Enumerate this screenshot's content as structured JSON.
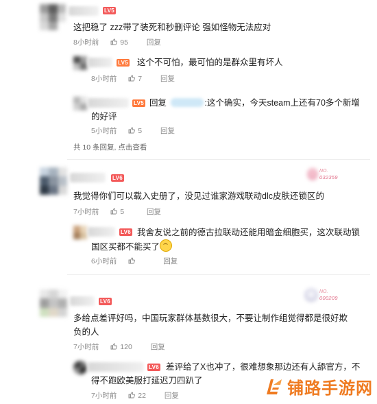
{
  "comments": [
    {
      "level": "LV5",
      "text": "这把稳了 zzz带了装死和秒删评论 强如怪物无法应对",
      "time": "8小时前",
      "likes": "95",
      "reply_label": "回复",
      "replies": [
        {
          "level": "LV5",
          "text": "这个不可怕，最可怕的是群众里有坏人",
          "time": "8小时前",
          "likes": "7",
          "reply_label": "回复"
        },
        {
          "level": "LV5",
          "reply_prefix": "回复",
          "text_after_mention": ":这个确实，今天steam上还有70多个新增",
          "text_line2": "的好评",
          "time": "5小时前",
          "likes": "5",
          "reply_label": "回复"
        }
      ],
      "reply_count_text": "共 10 条回复, 点击查看"
    },
    {
      "level": "LV6",
      "badge": {
        "prefix": "NO.",
        "number": "032359"
      },
      "text": "我觉得你们可以载入史册了，没见过谁家游戏联动dlc皮肤还锁区的",
      "time": "7小时前",
      "likes": "5",
      "reply_label": "回复",
      "replies": [
        {
          "level": "LV6",
          "text_line1": "我舍友说之前的德古拉联动还能用暗金细胞买，这次联动锁",
          "text_line2": "国区买都不能买了",
          "time": "6小时前",
          "likes": "",
          "reply_label": "回复"
        }
      ]
    },
    {
      "level": "LV6",
      "badge": {
        "prefix": "NO.",
        "number": "000209"
      },
      "text_line1": "多给点差评好吗，中国玩家群体基数很大，不要让制作组觉得都是很好欺",
      "text_line2": "负的人",
      "time": "7小时前",
      "likes": "120",
      "reply_label": "回复",
      "replies": [
        {
          "level": "LV6",
          "text_line1": "差评给了X也冲了，很难想象那边还有人舔官方，不",
          "text_line2": "得不跑欧美服打延迟刀四趴了",
          "time": "7小时前",
          "likes": "22",
          "reply_label": "回复"
        }
      ]
    }
  ],
  "watermark": {
    "text": "铺路手游网"
  },
  "colors": {
    "lv_red": "#f35a5a",
    "watermark_orange": "#ef7b21",
    "meta_gray": "#8a8a8a"
  }
}
